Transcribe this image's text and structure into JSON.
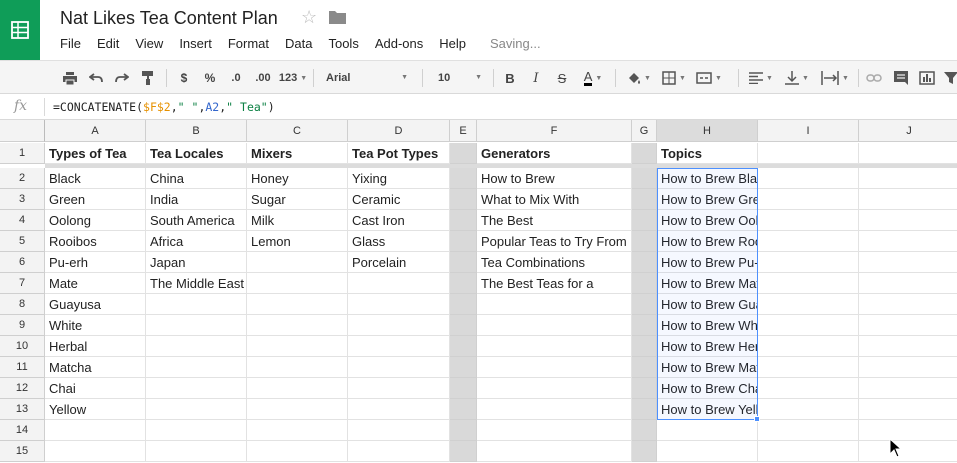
{
  "app": {
    "title": "Nat Likes Tea Content Plan",
    "logo_icon": "sheets-logo-icon",
    "brand_color": "#0f9d58",
    "status": "Saving..."
  },
  "menu": [
    "File",
    "Edit",
    "View",
    "Insert",
    "Format",
    "Data",
    "Tools",
    "Add-ons",
    "Help"
  ],
  "toolbar": {
    "currency": "$",
    "percent": "%",
    "dec_less": ".0",
    "dec_more": ".00",
    "more_formats": "123",
    "font": "Arial",
    "font_size": "10",
    "bold": "B",
    "italic": "I",
    "strike": "S",
    "text_color": "A"
  },
  "formula_bar": {
    "fx": "fx",
    "formula": "=CONCATENATE($F$2,\" \",A2,\" Tea\")"
  },
  "sheet": {
    "columns": [
      "A",
      "B",
      "C",
      "D",
      "E",
      "F",
      "G",
      "H",
      "I",
      "J"
    ],
    "rows": [
      "1",
      "2",
      "3",
      "4",
      "5",
      "6",
      "7",
      "8",
      "9",
      "10",
      "11",
      "12",
      "13",
      "14",
      "15"
    ],
    "headers": {
      "A": "Types of Tea",
      "B": "Tea Locales",
      "C": "Mixers",
      "D": "Tea Pot Types",
      "F": "Generators",
      "H": "Topics"
    },
    "col_a": [
      "Black",
      "Green",
      "Oolong",
      "Rooibos",
      "Pu-erh",
      "Mate",
      "Guayusa",
      "White",
      "Herbal",
      "Matcha",
      "Chai",
      "Yellow"
    ],
    "col_b": [
      "China",
      "India",
      "South America",
      "Africa",
      "Japan",
      "The Middle East"
    ],
    "col_c": [
      "Honey",
      "Sugar",
      "Milk",
      "Lemon"
    ],
    "col_d": [
      "Yixing",
      "Ceramic",
      "Cast Iron",
      "Glass",
      "Porcelain"
    ],
    "col_f": [
      "How to Brew",
      "What to Mix With",
      "The Best",
      "Popular Teas to Try From",
      "Tea Combinations",
      "The Best Teas for a"
    ],
    "col_h": [
      "How to Brew Black Tea",
      "How to Brew Green Tea",
      "How to Brew Oolong Tea",
      "How to Brew Rooibos Tea",
      "How to Brew Pu-erh Tea",
      "How to Brew Mate Tea",
      "How to Brew Guayusa Tea",
      "How to Brew White Tea",
      "How to Brew Herbal Tea",
      "How to Brew Matcha Tea",
      "How to Brew Chai Tea",
      "How to Brew Yellow Tea"
    ],
    "selected_range": "H2:H13"
  }
}
